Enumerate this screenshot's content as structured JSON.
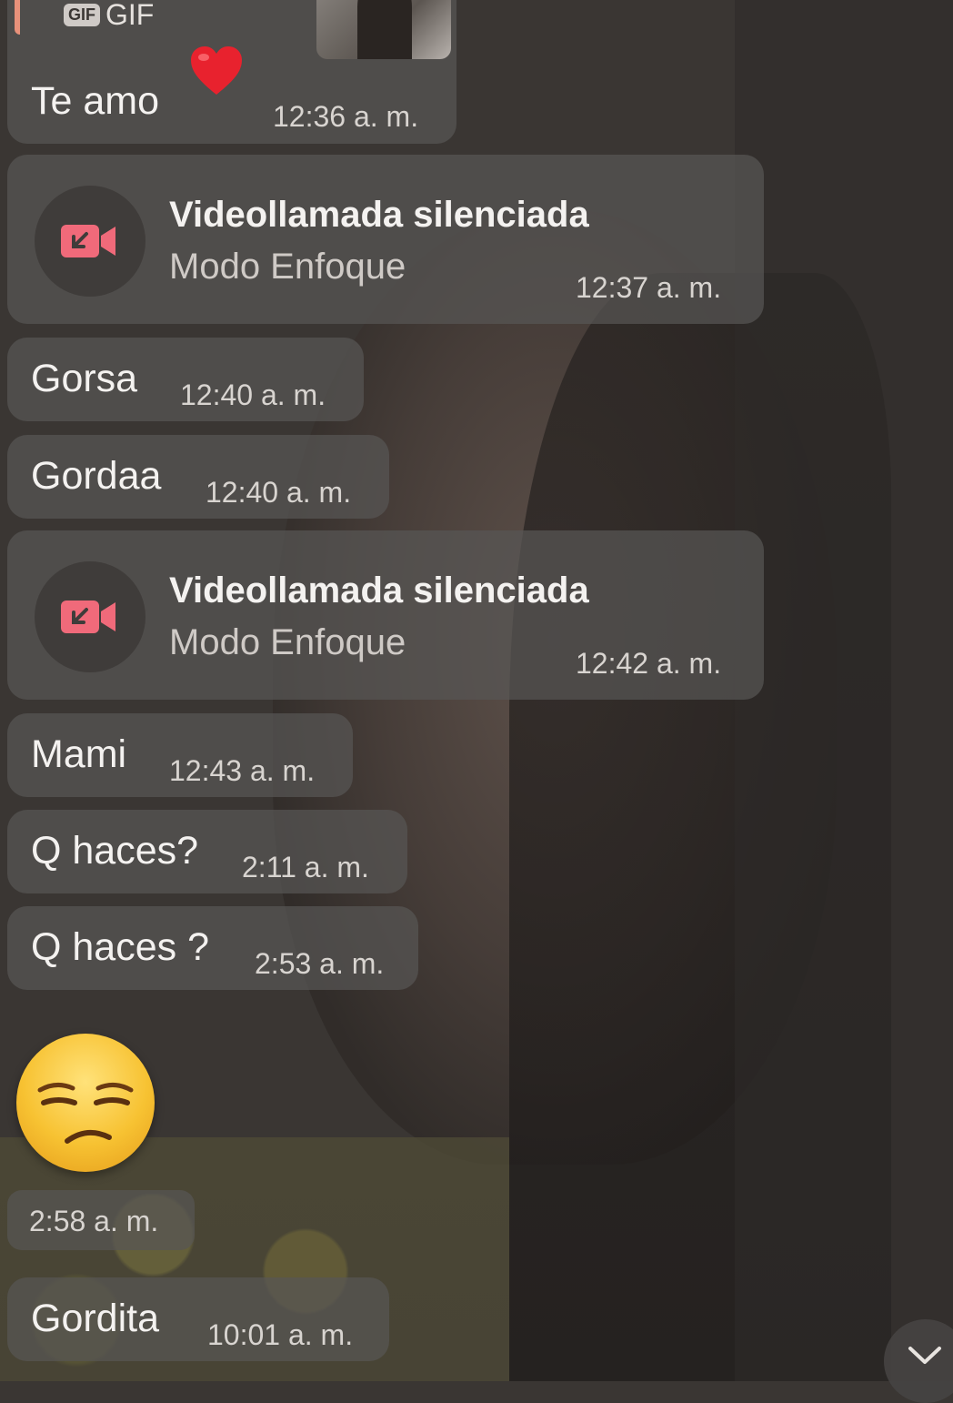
{
  "messages": [
    {
      "type": "gif_reply",
      "gif_label": "GIF",
      "gif_badge": "GIF",
      "text": "Te amo",
      "time": "12:36 a. m.",
      "has_heart": true
    },
    {
      "type": "call",
      "title": "Videollamada silenciada",
      "subtitle": "Modo Enfoque",
      "time": "12:37 a. m."
    },
    {
      "type": "text",
      "text": "Gorsa",
      "time": "12:40 a. m."
    },
    {
      "type": "text",
      "text": "Gordaa",
      "time": "12:40 a. m."
    },
    {
      "type": "call",
      "title": "Videollamada silenciada",
      "subtitle": "Modo Enfoque",
      "time": "12:42 a. m."
    },
    {
      "type": "text",
      "text": "Mami",
      "time": "12:43 a. m."
    },
    {
      "type": "text",
      "text": "Q haces?",
      "time": "2:11 a. m."
    },
    {
      "type": "text",
      "text": "Q haces ?",
      "time": "2:53 a. m."
    },
    {
      "type": "emoji",
      "emoji": "unamused-face",
      "time": "2:58 a. m."
    },
    {
      "type": "text",
      "text": "Gordita",
      "time": "10:01 a. m."
    }
  ],
  "colors": {
    "call_icon_accent": "#f06a7a",
    "gif_reply_accent": "#e8917a"
  },
  "icons": {
    "call": "missed-video-call-icon",
    "scroll": "chevron-down-icon"
  }
}
